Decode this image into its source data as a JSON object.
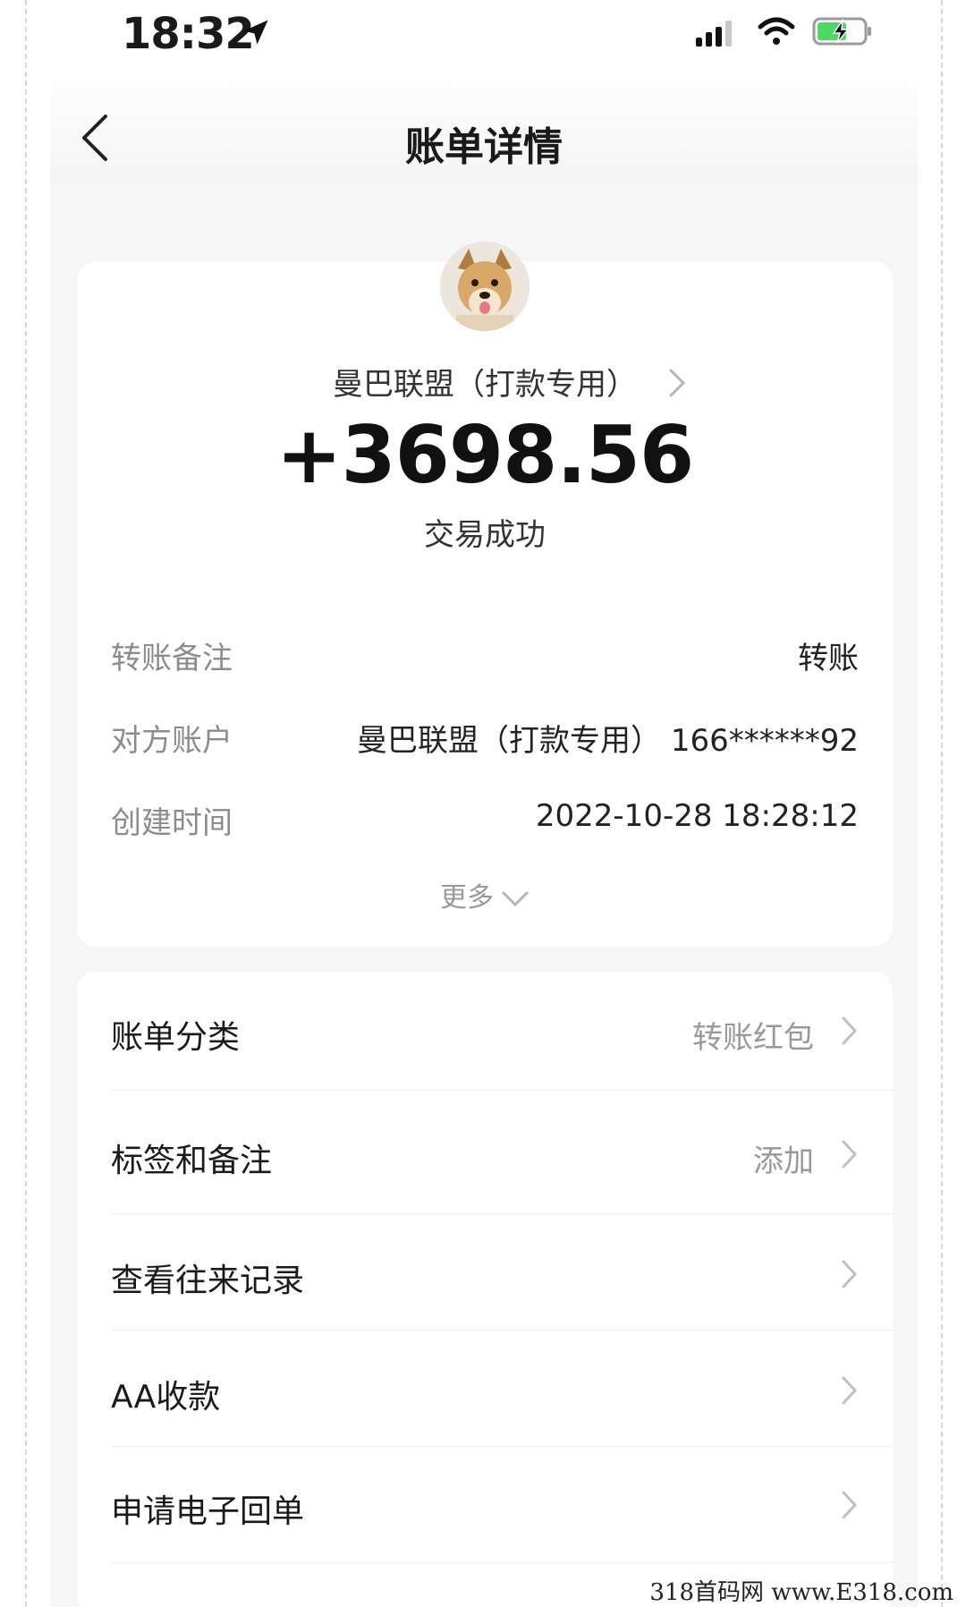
{
  "status_bar": {
    "time": "18:32"
  },
  "header": {
    "title": "账单详情"
  },
  "summary": {
    "payee": "曼巴联盟（打款专用）",
    "amount": "+3698.56",
    "status": "交易成功"
  },
  "details": [
    {
      "label": "转账备注",
      "value": "转账"
    },
    {
      "label": "对方账户",
      "value": "曼巴联盟（打款专用） 166******92"
    },
    {
      "label": "创建时间",
      "value": "2022-10-28 18:28:12"
    }
  ],
  "more_label": "更多",
  "menu": [
    {
      "label": "账单分类",
      "value": "转账红包"
    },
    {
      "label": "标签和备注",
      "value": "添加"
    },
    {
      "label": "查看往来记录",
      "value": ""
    },
    {
      "label": "AA收款",
      "value": ""
    },
    {
      "label": "申请电子回单",
      "value": ""
    }
  ],
  "watermark": "318首码网 www.E318.com"
}
